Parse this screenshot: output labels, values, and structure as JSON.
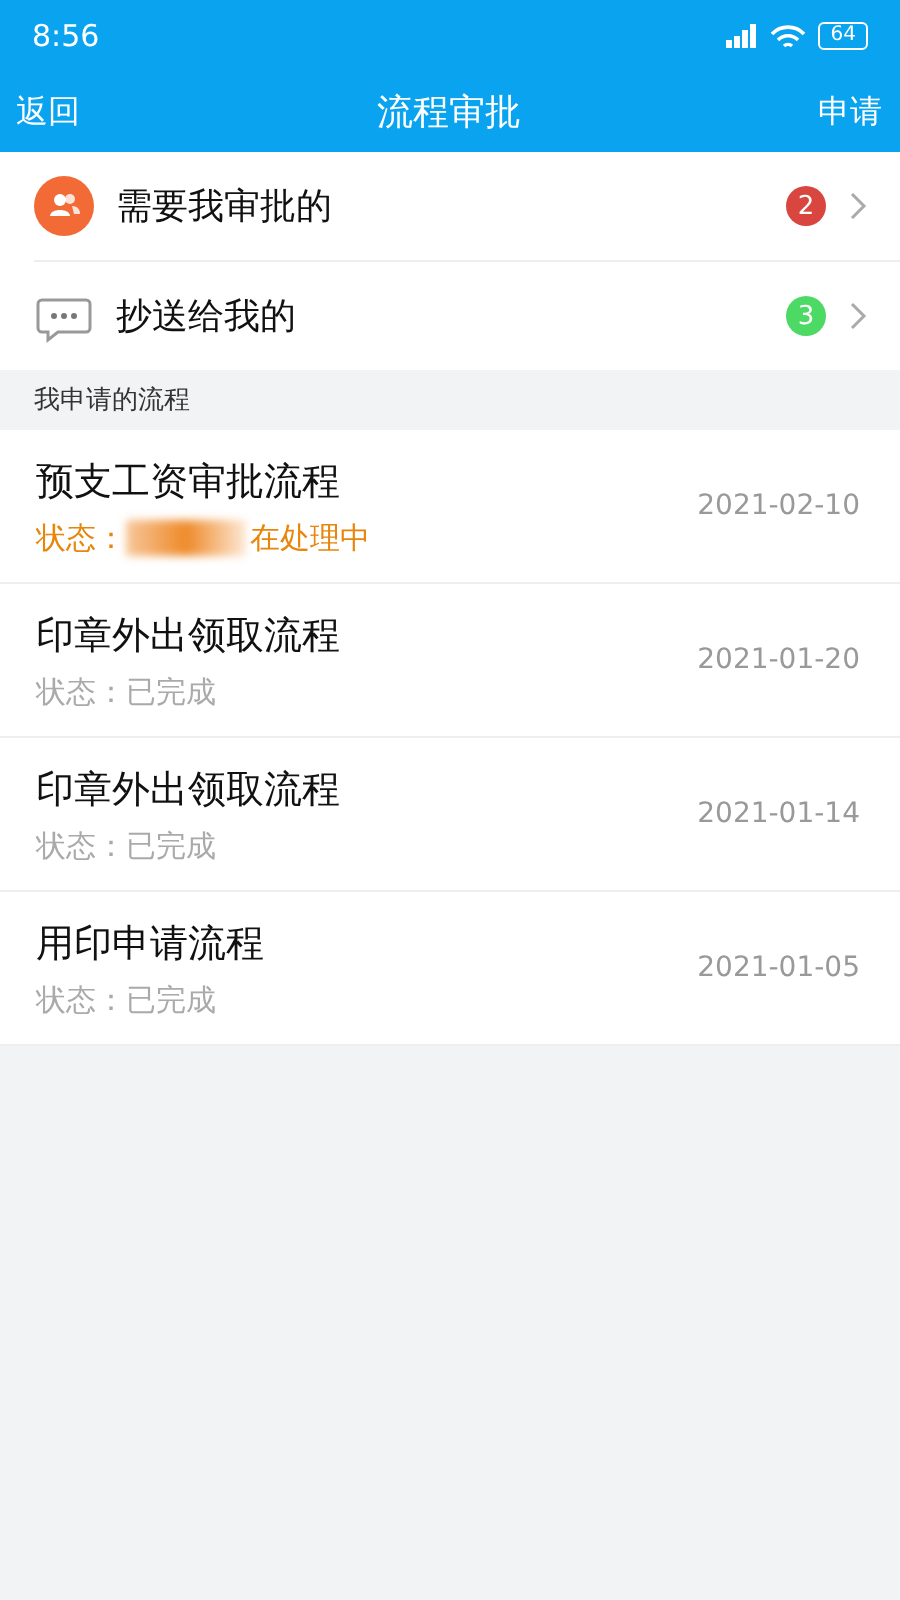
{
  "status_bar": {
    "time": "8:56",
    "battery": "64"
  },
  "nav": {
    "back": "返回",
    "title": "流程审批",
    "action": "申请"
  },
  "menu": [
    {
      "kind": "approve",
      "label": "需要我审批的",
      "count": "2",
      "color": "#d9453f"
    },
    {
      "kind": "cc",
      "label": "抄送给我的",
      "count": "3",
      "color": "#4cd964"
    }
  ],
  "section_title": "我申请的流程",
  "processes": [
    {
      "title": "预支工资审批流程",
      "status_label": "状态：",
      "status": "在处理中",
      "kind": "processing",
      "redacted": true,
      "date": "2021-02-10"
    },
    {
      "title": "印章外出领取流程",
      "status_label": "状态：",
      "status": "已完成",
      "kind": "done",
      "redacted": false,
      "date": "2021-01-20"
    },
    {
      "title": "印章外出领取流程",
      "status_label": "状态：",
      "status": "已完成",
      "kind": "done",
      "redacted": false,
      "date": "2021-01-14"
    },
    {
      "title": "用印申请流程",
      "status_label": "状态：",
      "status": "已完成",
      "kind": "done",
      "redacted": false,
      "date": "2021-01-05"
    }
  ]
}
